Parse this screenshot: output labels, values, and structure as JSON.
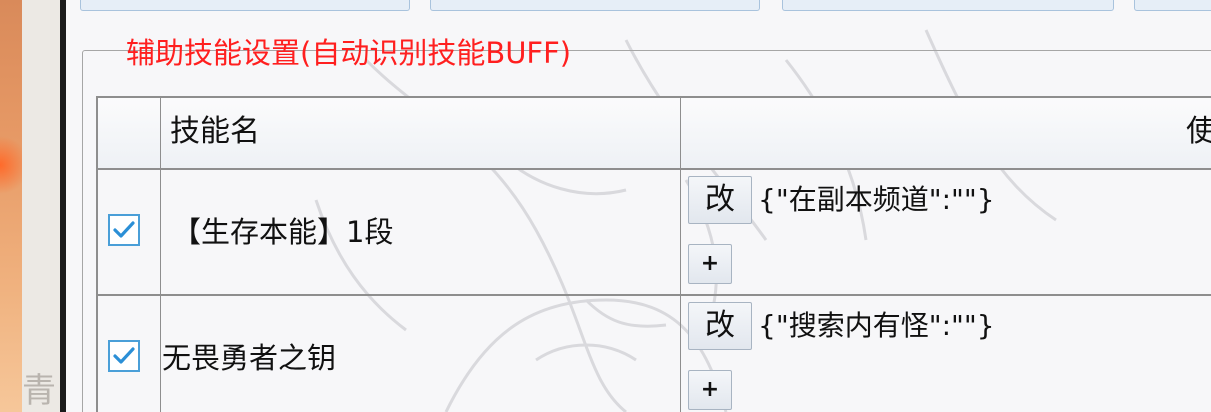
{
  "background": {
    "left_panel_char": "青"
  },
  "group": {
    "title": "辅助技能设置(自动识别技能BUFF)",
    "title_color": "#ff1f1f"
  },
  "table": {
    "headers": {
      "checkbox": "",
      "skill_name": "技能名",
      "use_condition": "使"
    },
    "rows": [
      {
        "checked": true,
        "skill_name": "【生存本能】1段",
        "edit_label": "改",
        "condition": "{\"在副本频道\":\"\"}",
        "add_label": "+"
      },
      {
        "checked": true,
        "skill_name": "无畏勇者之钥",
        "edit_label": "改",
        "condition": "{\"搜索内有怪\":\"\"}",
        "add_label": "+"
      }
    ]
  },
  "colors": {
    "checkbox_border": "#4a9fd8",
    "checkmark": "#2b8fd6",
    "grid_line": "#8e8e8e"
  }
}
